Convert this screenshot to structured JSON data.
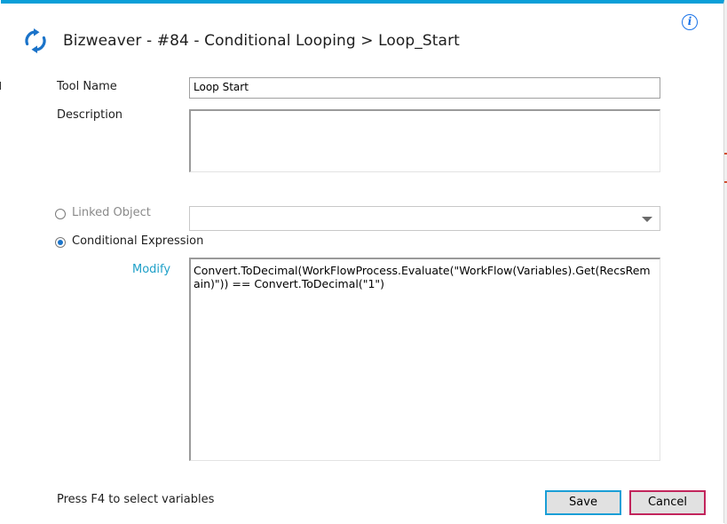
{
  "window": {
    "title": "Bizweaver - #84 - Conditional Looping > Loop_Start"
  },
  "form": {
    "tool_name_label": "Tool Name",
    "tool_name_value": "Loop Start",
    "description_label": "Description",
    "description_value": "",
    "linked_object_label": "Linked Object",
    "linked_object_value": "",
    "conditional_expression_label": "Conditional Expression",
    "selected_option": "Conditional Expression",
    "modify_link": "Modify",
    "expression_value": "Convert.ToDecimal(WorkFlowProcess.Evaluate(\"WorkFlow(Variables).Get(RecsRemain)\")) == Convert.ToDecimal(\"1\")"
  },
  "footer": {
    "hint": "Press F4 to select variables",
    "save_label": "Save",
    "cancel_label": "Cancel"
  },
  "icons": {
    "app": "refresh-arrows-icon",
    "info": "info-icon",
    "dropdown": "chevron-down-icon"
  },
  "colors": {
    "accent": "#0a9fd8",
    "link": "#1ea0c8",
    "radio_selected": "#1a73c9",
    "cancel_border": "#c2255c",
    "save_border": "#1a9ed6"
  }
}
